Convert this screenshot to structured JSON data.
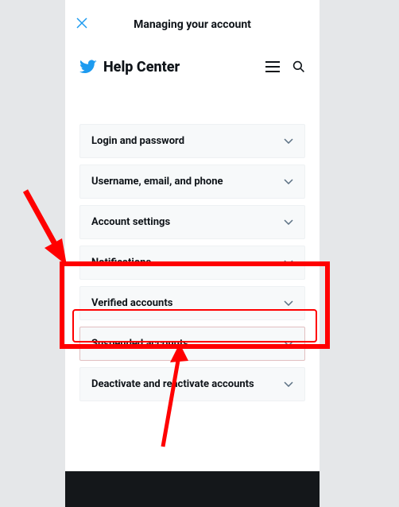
{
  "status_bar": {
    "time": "",
    "indicators": ""
  },
  "nav": {
    "close_label": "✕",
    "title": "Managing your account"
  },
  "help_header": {
    "brand_text": "Help Center"
  },
  "accordion": {
    "items": [
      {
        "label": "Login and password"
      },
      {
        "label": "Username, email, and phone"
      },
      {
        "label": "Account settings"
      },
      {
        "label": "Notifications"
      },
      {
        "label": "Verified accounts"
      },
      {
        "label": "Suspended accounts"
      },
      {
        "label": "Deactivate and reactivate accounts"
      }
    ]
  },
  "annotations": {
    "highlight_color": "#ff0000"
  }
}
